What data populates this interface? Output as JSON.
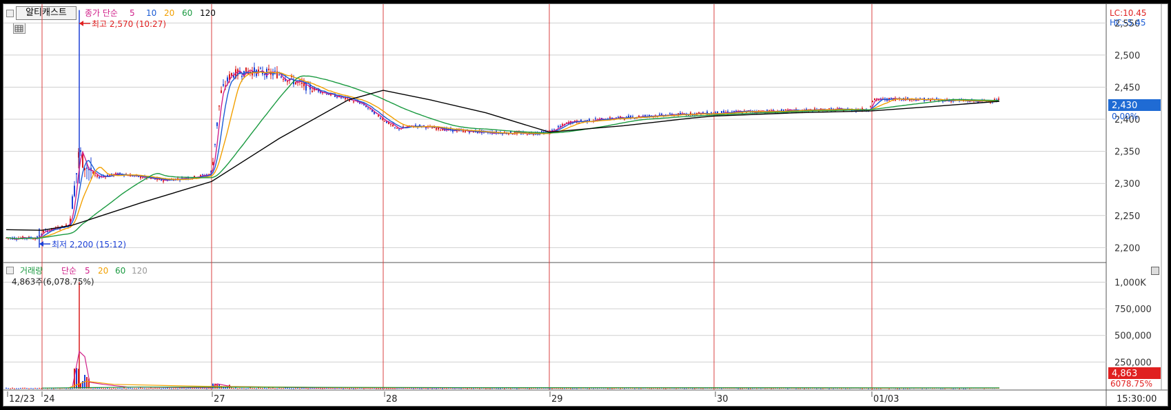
{
  "price_panel": {
    "title_button": "알티캐스트",
    "ma_label": "종가 단순",
    "ma_periods": [
      "5",
      "10",
      "20",
      "60",
      "120"
    ],
    "high_marker": "최고 2,570 (10:27)",
    "low_marker": "최저 2,200 (15:12)",
    "lc_label": "LC:10.45",
    "hc_label": "HC:-5.45",
    "current_price": "2,430",
    "current_change": "0.00%"
  },
  "volume_panel": {
    "label": "거래량",
    "ma_label": "단순",
    "ma_periods": [
      "5",
      "20",
      "60",
      "120"
    ],
    "info": "4,863주(6,078.75%)",
    "current_volume": "4,863",
    "current_ratio": "6078.75%"
  },
  "x_axis": {
    "date_labels": [
      "12/23",
      "24",
      "27",
      "28",
      "29",
      "30",
      "01/03"
    ],
    "time_label": "15:30:00"
  },
  "colors": {
    "ma5": "#d0208a",
    "ma10": "#1a5bd4",
    "ma20": "#f2a000",
    "ma60": "#1a9a40",
    "ma120": "#000000",
    "candle_up": "#d81a1a",
    "candle_down": "#1a3fd6",
    "session_line": "#d84040",
    "price_badge": "#1f6bd4",
    "volume_badge": "#e02020"
  },
  "chart_data": [
    {
      "type": "line",
      "title": "",
      "x": [
        "12/23",
        "24 09:00",
        "24 10:27",
        "24 12:00",
        "24 15:12",
        "27 09:00",
        "27 10:30",
        "27 13:00",
        "28 09:00",
        "28 12:00",
        "29 09:00",
        "29 13:00",
        "30 09:00",
        "30 13:00",
        "01/03 09:00",
        "01/03 12:00",
        "01/03 15:30"
      ],
      "series": [
        {
          "values": [
            2215,
            2220,
            2570,
            2310,
            2300,
            2320,
            2470,
            2440,
            2400,
            2380,
            2380,
            2400,
            2410,
            2410,
            2420,
            2425,
            2430
          ]
        }
      ],
      "ylim": [
        2180,
        2560
      ],
      "y_ticks": [
        "2,200",
        "2,250",
        "2,300",
        "2,350",
        "2,400",
        "2,450",
        "2,500",
        "2,550"
      ],
      "high": 2570,
      "low": 2200
    },
    {
      "type": "bar",
      "title": "",
      "ylim": [
        0,
        1100000
      ],
      "y_ticks": [
        "250,000",
        "500,000",
        "750,000",
        "1,000K"
      ],
      "values": [
        4863
      ]
    }
  ]
}
